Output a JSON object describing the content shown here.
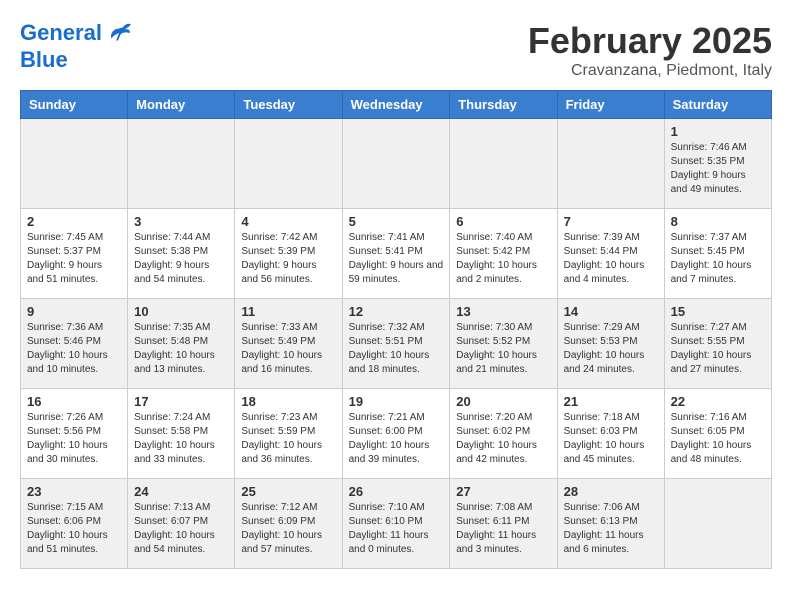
{
  "header": {
    "logo_line1": "General",
    "logo_line2": "Blue",
    "month_title": "February 2025",
    "subtitle": "Cravanzana, Piedmont, Italy"
  },
  "weekdays": [
    "Sunday",
    "Monday",
    "Tuesday",
    "Wednesday",
    "Thursday",
    "Friday",
    "Saturday"
  ],
  "weeks": [
    [
      {
        "day": "",
        "info": ""
      },
      {
        "day": "",
        "info": ""
      },
      {
        "day": "",
        "info": ""
      },
      {
        "day": "",
        "info": ""
      },
      {
        "day": "",
        "info": ""
      },
      {
        "day": "",
        "info": ""
      },
      {
        "day": "1",
        "info": "Sunrise: 7:46 AM\nSunset: 5:35 PM\nDaylight: 9 hours and 49 minutes."
      }
    ],
    [
      {
        "day": "2",
        "info": "Sunrise: 7:45 AM\nSunset: 5:37 PM\nDaylight: 9 hours and 51 minutes."
      },
      {
        "day": "3",
        "info": "Sunrise: 7:44 AM\nSunset: 5:38 PM\nDaylight: 9 hours and 54 minutes."
      },
      {
        "day": "4",
        "info": "Sunrise: 7:42 AM\nSunset: 5:39 PM\nDaylight: 9 hours and 56 minutes."
      },
      {
        "day": "5",
        "info": "Sunrise: 7:41 AM\nSunset: 5:41 PM\nDaylight: 9 hours and 59 minutes."
      },
      {
        "day": "6",
        "info": "Sunrise: 7:40 AM\nSunset: 5:42 PM\nDaylight: 10 hours and 2 minutes."
      },
      {
        "day": "7",
        "info": "Sunrise: 7:39 AM\nSunset: 5:44 PM\nDaylight: 10 hours and 4 minutes."
      },
      {
        "day": "8",
        "info": "Sunrise: 7:37 AM\nSunset: 5:45 PM\nDaylight: 10 hours and 7 minutes."
      }
    ],
    [
      {
        "day": "9",
        "info": "Sunrise: 7:36 AM\nSunset: 5:46 PM\nDaylight: 10 hours and 10 minutes."
      },
      {
        "day": "10",
        "info": "Sunrise: 7:35 AM\nSunset: 5:48 PM\nDaylight: 10 hours and 13 minutes."
      },
      {
        "day": "11",
        "info": "Sunrise: 7:33 AM\nSunset: 5:49 PM\nDaylight: 10 hours and 16 minutes."
      },
      {
        "day": "12",
        "info": "Sunrise: 7:32 AM\nSunset: 5:51 PM\nDaylight: 10 hours and 18 minutes."
      },
      {
        "day": "13",
        "info": "Sunrise: 7:30 AM\nSunset: 5:52 PM\nDaylight: 10 hours and 21 minutes."
      },
      {
        "day": "14",
        "info": "Sunrise: 7:29 AM\nSunset: 5:53 PM\nDaylight: 10 hours and 24 minutes."
      },
      {
        "day": "15",
        "info": "Sunrise: 7:27 AM\nSunset: 5:55 PM\nDaylight: 10 hours and 27 minutes."
      }
    ],
    [
      {
        "day": "16",
        "info": "Sunrise: 7:26 AM\nSunset: 5:56 PM\nDaylight: 10 hours and 30 minutes."
      },
      {
        "day": "17",
        "info": "Sunrise: 7:24 AM\nSunset: 5:58 PM\nDaylight: 10 hours and 33 minutes."
      },
      {
        "day": "18",
        "info": "Sunrise: 7:23 AM\nSunset: 5:59 PM\nDaylight: 10 hours and 36 minutes."
      },
      {
        "day": "19",
        "info": "Sunrise: 7:21 AM\nSunset: 6:00 PM\nDaylight: 10 hours and 39 minutes."
      },
      {
        "day": "20",
        "info": "Sunrise: 7:20 AM\nSunset: 6:02 PM\nDaylight: 10 hours and 42 minutes."
      },
      {
        "day": "21",
        "info": "Sunrise: 7:18 AM\nSunset: 6:03 PM\nDaylight: 10 hours and 45 minutes."
      },
      {
        "day": "22",
        "info": "Sunrise: 7:16 AM\nSunset: 6:05 PM\nDaylight: 10 hours and 48 minutes."
      }
    ],
    [
      {
        "day": "23",
        "info": "Sunrise: 7:15 AM\nSunset: 6:06 PM\nDaylight: 10 hours and 51 minutes."
      },
      {
        "day": "24",
        "info": "Sunrise: 7:13 AM\nSunset: 6:07 PM\nDaylight: 10 hours and 54 minutes."
      },
      {
        "day": "25",
        "info": "Sunrise: 7:12 AM\nSunset: 6:09 PM\nDaylight: 10 hours and 57 minutes."
      },
      {
        "day": "26",
        "info": "Sunrise: 7:10 AM\nSunset: 6:10 PM\nDaylight: 11 hours and 0 minutes."
      },
      {
        "day": "27",
        "info": "Sunrise: 7:08 AM\nSunset: 6:11 PM\nDaylight: 11 hours and 3 minutes."
      },
      {
        "day": "28",
        "info": "Sunrise: 7:06 AM\nSunset: 6:13 PM\nDaylight: 11 hours and 6 minutes."
      },
      {
        "day": "",
        "info": ""
      }
    ]
  ]
}
